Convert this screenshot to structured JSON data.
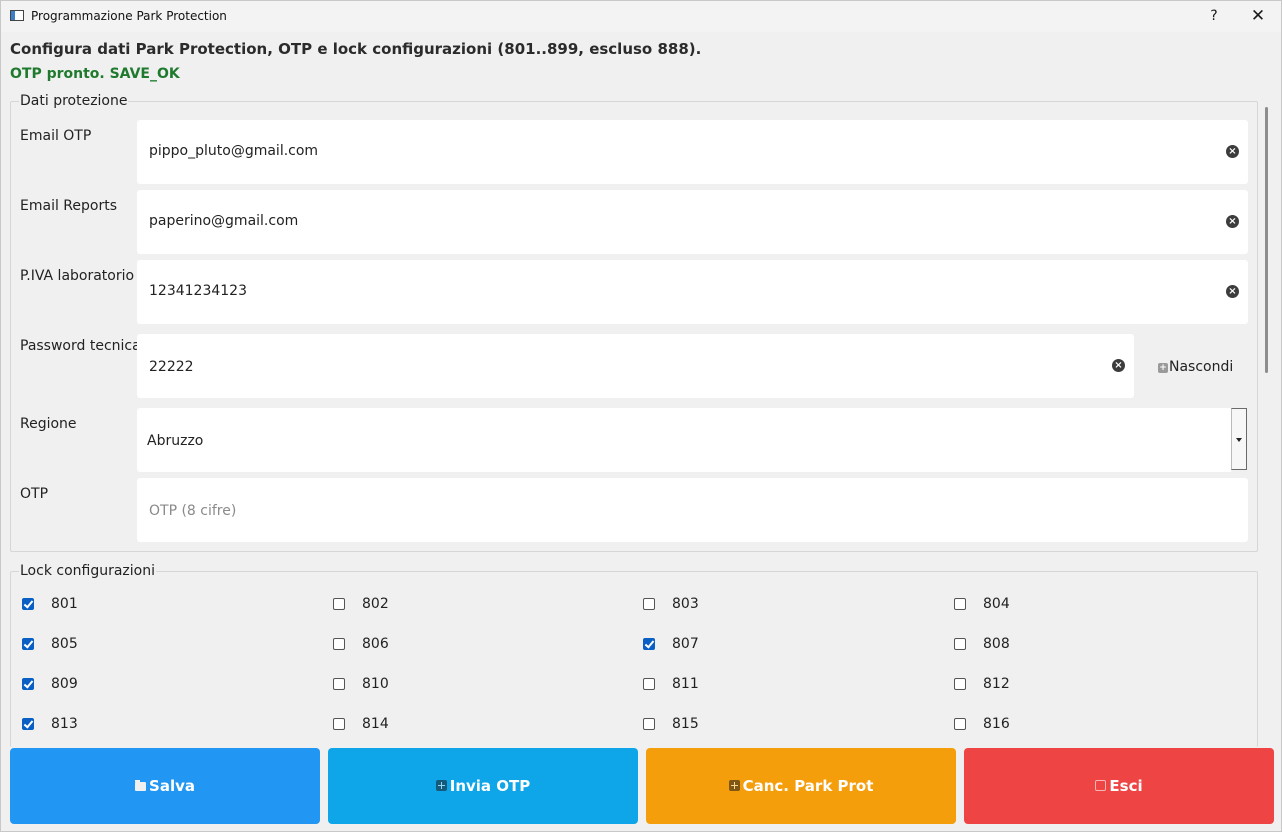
{
  "window": {
    "title": "Programmazione Park Protection",
    "help_label": "?",
    "close_label": "✕"
  },
  "header": {
    "heading": "Configura dati Park Protection, OTP e lock configurazioni (801..899, escluso 888).",
    "status": "OTP pronto. SAVE_OK"
  },
  "protection": {
    "title": "Dati protezione",
    "email_otp": {
      "label": "Email OTP",
      "value": "pippo_pluto@gmail.com"
    },
    "email_reports": {
      "label": "Email Reports",
      "value": "paperino@gmail.com"
    },
    "piva": {
      "label": "P.IVA laboratorio",
      "value": "12341234123"
    },
    "password": {
      "label": "Password tecnica",
      "value": "22222",
      "toggle_label": "Nascondi"
    },
    "region": {
      "label": "Regione",
      "value": "Abruzzo"
    },
    "otp": {
      "label": "OTP",
      "placeholder": "OTP (8 cifre)"
    }
  },
  "locks": {
    "title": "Lock configurazioni",
    "items": [
      {
        "label": "801",
        "checked": true
      },
      {
        "label": "802",
        "checked": false
      },
      {
        "label": "803",
        "checked": false
      },
      {
        "label": "804",
        "checked": false
      },
      {
        "label": "805",
        "checked": true
      },
      {
        "label": "806",
        "checked": false
      },
      {
        "label": "807",
        "checked": true
      },
      {
        "label": "808",
        "checked": false
      },
      {
        "label": "809",
        "checked": true
      },
      {
        "label": "810",
        "checked": false
      },
      {
        "label": "811",
        "checked": false
      },
      {
        "label": "812",
        "checked": false
      },
      {
        "label": "813",
        "checked": true
      },
      {
        "label": "814",
        "checked": false
      },
      {
        "label": "815",
        "checked": false
      },
      {
        "label": "816",
        "checked": false
      }
    ]
  },
  "actions": {
    "save": {
      "label": "Salva",
      "color": "#2196f3",
      "icon": "folder-icon"
    },
    "send_otp": {
      "label": "Invia OTP",
      "color": "#0ea5e9",
      "icon": "plus-icon"
    },
    "cancel_park": {
      "label": "Canc. Park Prot",
      "color": "#f59e0b",
      "icon": "plus-icon"
    },
    "exit": {
      "label": "Esci",
      "color": "#ef4444",
      "icon": "exit-icon"
    }
  }
}
